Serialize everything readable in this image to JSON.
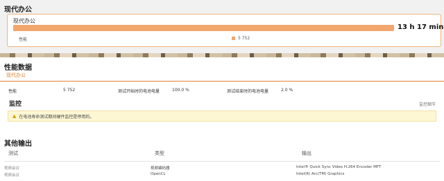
{
  "summary": {
    "title": "现代办公",
    "card_title": "现代办公",
    "duration": "13 h 17 min",
    "warning_icon": "warning-icon",
    "performance_label": "性能",
    "legend_value": "5 752",
    "accent": "#f2a66e"
  },
  "performance": {
    "title": "性能数据",
    "tab_label": "现代办公",
    "fields": [
      {
        "label": "性能",
        "value": "5 752"
      },
      {
        "label": "测试开始时的电池电量",
        "value": "100.0 %"
      },
      {
        "label": "测试结束时的电池电量",
        "value": "2.0 %"
      }
    ],
    "monitor_title": "监控",
    "monitor_link": "监控细节",
    "monitor_warning": "在电池寿命测试期间硬件监控是停用的。"
  },
  "other_output": {
    "title": "其他输出",
    "columns": [
      "测试",
      "类型",
      "输出"
    ],
    "rows": [
      [
        "视频会议",
        "视频编码器",
        "Intel® Quick Sync Video H.264 Encoder MFT"
      ],
      [
        "视频会议",
        "OpenCL",
        "Intel(R) Arc(TM) Graphics"
      ]
    ]
  }
}
